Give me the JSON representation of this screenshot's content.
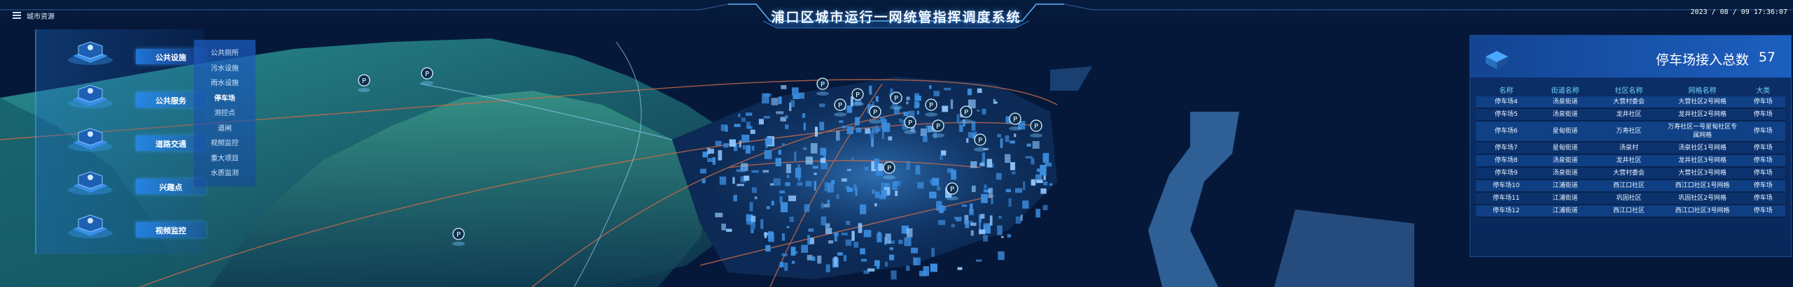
{
  "header": {
    "menu_label": "城市资源",
    "title": "浦口区城市运行一网统管指挥调度系统",
    "datetime": "2023 / 08 / 09  17:36:07"
  },
  "left_panel": {
    "categories": [
      {
        "label": "公共设施",
        "icon": "park-facility-icon"
      },
      {
        "label": "公共服务",
        "icon": "public-service-icon"
      },
      {
        "label": "道路交通",
        "icon": "road-traffic-icon"
      },
      {
        "label": "兴趣点",
        "icon": "poi-icon"
      },
      {
        "label": "视频监控",
        "icon": "video-camera-icon"
      }
    ],
    "sub_items": [
      "公共厕所",
      "污水设施",
      "雨水设施",
      "停车场",
      "测控点",
      "道闸",
      "视频监控",
      "重大项目",
      "水质监测"
    ],
    "active_sub": "停车场"
  },
  "right_panel": {
    "title": "停车场接入总数",
    "count": "57",
    "columns": [
      "名称",
      "街道名称",
      "社区名称",
      "网格名称",
      "大类"
    ],
    "rows": [
      [
        "停车场4",
        "汤泉街道",
        "大营村委会",
        "大营社区2号网格",
        "停车场"
      ],
      [
        "停车场5",
        "汤泉街道",
        "龙井社区",
        "龙井社区2号网格",
        "停车场"
      ],
      [
        "停车场6",
        "星甸街道",
        "万寿社区",
        "万寿社区一号星甸社区专属网格",
        "停车场"
      ],
      [
        "停车场7",
        "星甸街道",
        "汤泉村",
        "汤泉社区1号网格",
        "停车场"
      ],
      [
        "停车场8",
        "汤泉街道",
        "龙井社区",
        "龙井社区3号网格",
        "停车场"
      ],
      [
        "停车场9",
        "汤泉街道",
        "大营村委会",
        "大营社区3号网格",
        "停车场"
      ],
      [
        "停车场10",
        "江浦街道",
        "西江口社区",
        "西江口社区1号网格",
        "停车场"
      ],
      [
        "停车场11",
        "江浦街道",
        "巩固社区",
        "巩固社区2号网格",
        "停车场"
      ],
      [
        "停车场12",
        "江浦街道",
        "西江口社区",
        "西江口社区3号网格",
        "停车场"
      ]
    ]
  },
  "map": {
    "parking_marker_label": "P",
    "colors": {
      "sea": "#06183a",
      "terrain": "#1e6b78",
      "river": "#2e5f95",
      "buildings": "#3c8ee0",
      "roads": "#c46a4a"
    }
  }
}
